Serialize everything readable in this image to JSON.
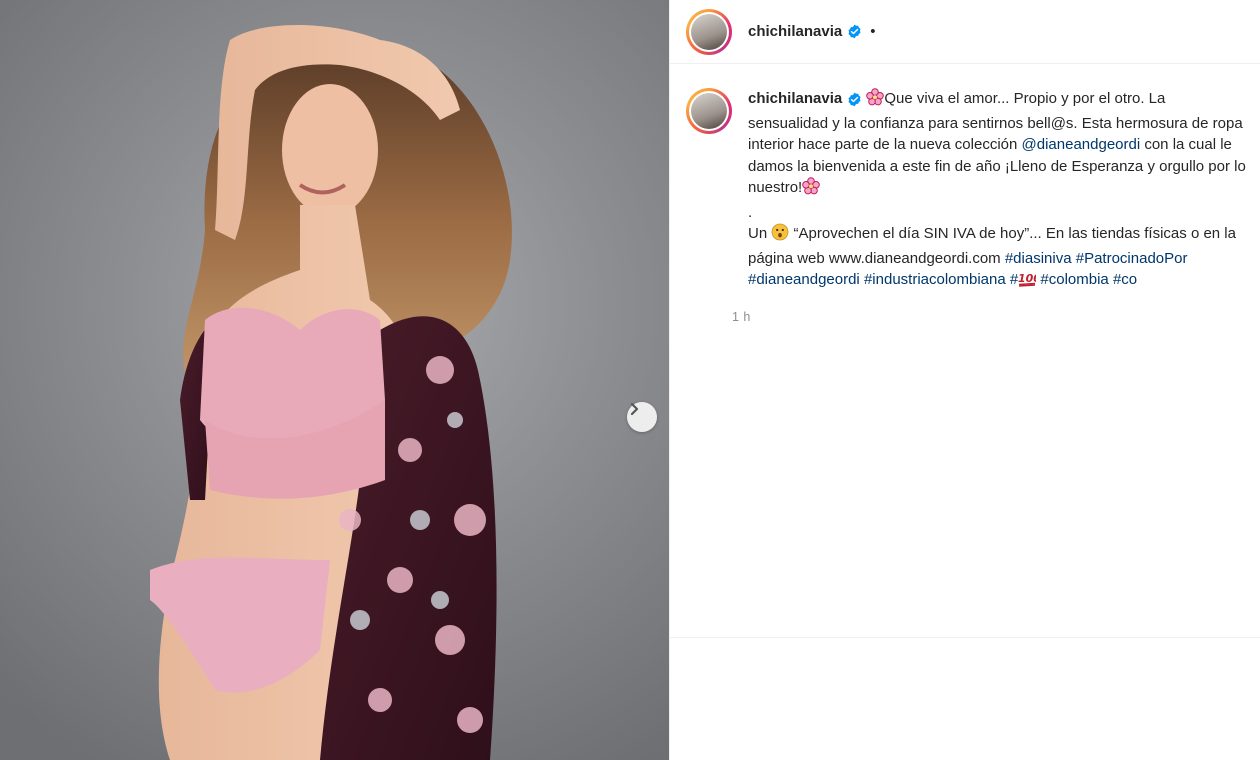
{
  "post": {
    "username": "chichilanavia",
    "header_separator": "•",
    "caption": {
      "line1": "Que viva el amor... Propio y por el otro. La sensualidad y la confianza para sentirnos bell@s. Esta hermosura de ropa interior hace parte de la nueva colección ",
      "mention": "@dianeandgeordi",
      "line2": " con la cual le damos la bienvenida a este fin de año ¡Lleno de Esperanza y orgullo por lo nuestro!",
      "dot": ".",
      "line3_start": "Un ",
      "line3": " “Aprovechen el día SIN IVA de hoy”... En las tiendas físicas o en la página web www.dianeandgeordi.com ",
      "hashtags": [
        "#diasiniva",
        "#PatrocinadoPor",
        "#dianeandgeordi",
        "#industriacolombiana",
        "#",
        "#colombia",
        "#co"
      ]
    },
    "timestamp": "1 h"
  },
  "icons": {
    "verified": "verified-badge-icon",
    "flower": "cherry-blossom-emoji",
    "face": "hushed-face-emoji",
    "hundred": "hundred-points-emoji",
    "next": "chevron-right-icon"
  },
  "colors": {
    "link": "#00376b",
    "verified": "#0095f6",
    "muted": "#8e8e8e"
  }
}
